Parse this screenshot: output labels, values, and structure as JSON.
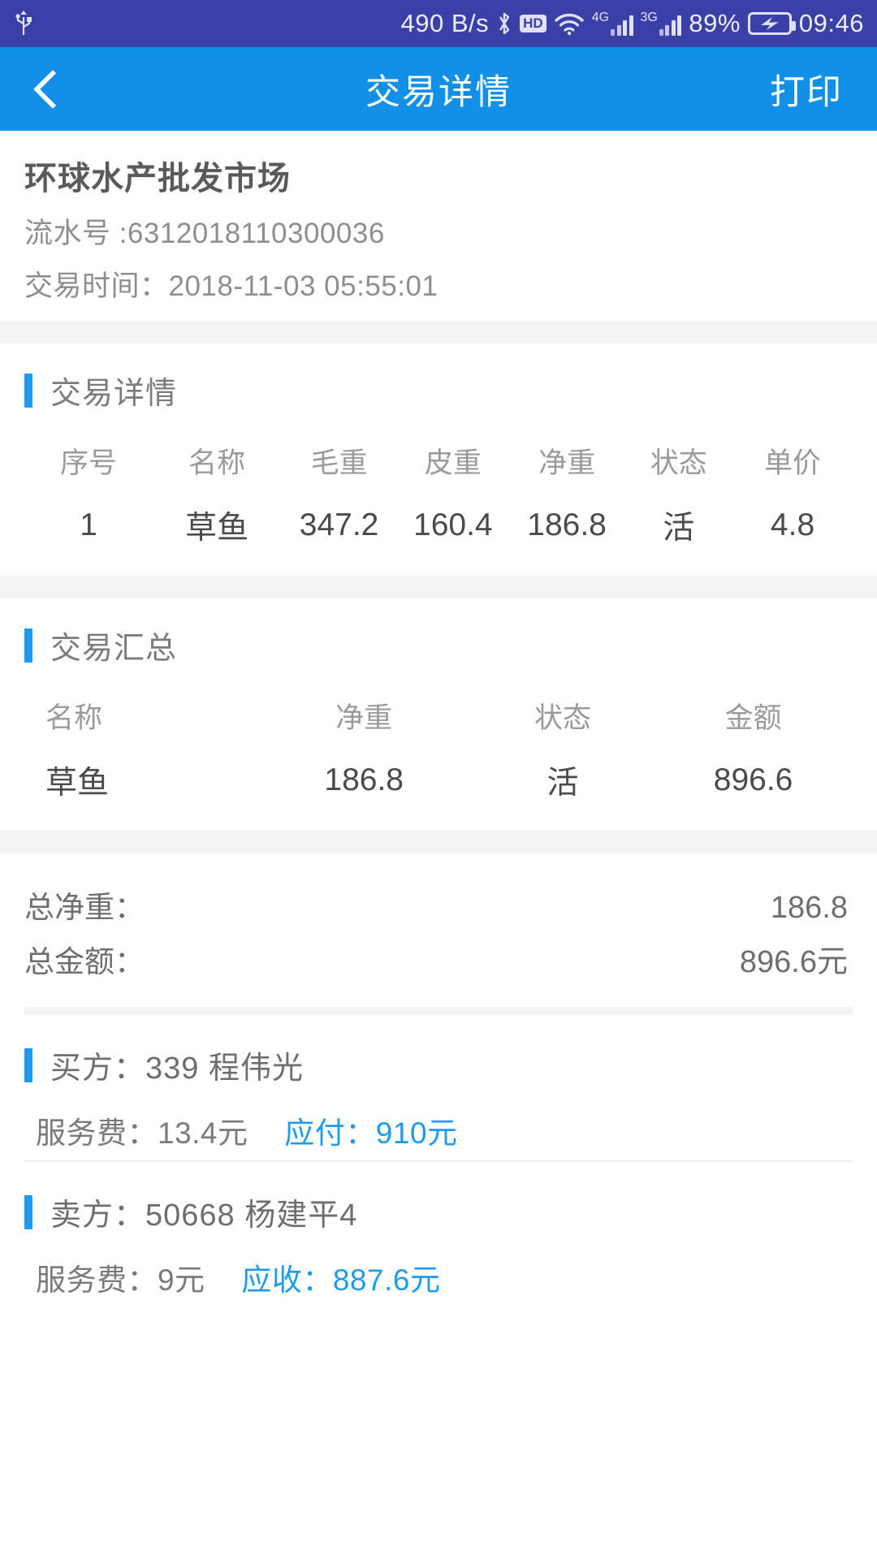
{
  "statusbar": {
    "usb_icon": "usb-icon",
    "netspeed": "490 B/s",
    "bluetooth_icon": "bluetooth-icon",
    "hd_label": "HD",
    "wifi_icon": "wifi-icon",
    "sim1_gen": "4G",
    "sim2_gen": "3G",
    "battery_pct": "89%",
    "battery_icon": "battery-charging-icon",
    "time": "09:46"
  },
  "titlebar": {
    "back_icon": "back-chevron-icon",
    "title": "交易详情",
    "print_label": "打印"
  },
  "market": {
    "name": "环球水产批发市场",
    "serial": "流水号 :6312018110300036",
    "time": "交易时间：2018-11-03 05:55:01"
  },
  "detail_section": {
    "title": "交易详情",
    "columns": [
      "序号",
      "名称",
      "毛重",
      "皮重",
      "净重",
      "状态",
      "单价"
    ],
    "rows": [
      [
        "1",
        "草鱼",
        "347.2",
        "160.4",
        "186.8",
        "活",
        "4.8"
      ]
    ]
  },
  "summary_section": {
    "title": "交易汇总",
    "columns": [
      "名称",
      "净重",
      "状态",
      "金额"
    ],
    "rows": [
      [
        "草鱼",
        "186.8",
        "活",
        "896.6"
      ]
    ]
  },
  "totals": {
    "net_weight_label": "总净重：",
    "net_weight_value": "186.8",
    "amount_label": "总金额：",
    "amount_value": "896.6元"
  },
  "buyer": {
    "title": "买方：339  程伟光",
    "fee_label": "服务费：13.4元",
    "due_label": "应付：910元"
  },
  "seller": {
    "title": "卖方：50668  杨建平4",
    "fee_label": "服务费：9元",
    "due_label": "应收：887.6元"
  },
  "colors": {
    "statusbar_bg": "#3b3fa8",
    "titlebar_bg": "#1290e8",
    "accent_blue": "#1d9bf0",
    "band_gray": "#f4f4f4"
  }
}
